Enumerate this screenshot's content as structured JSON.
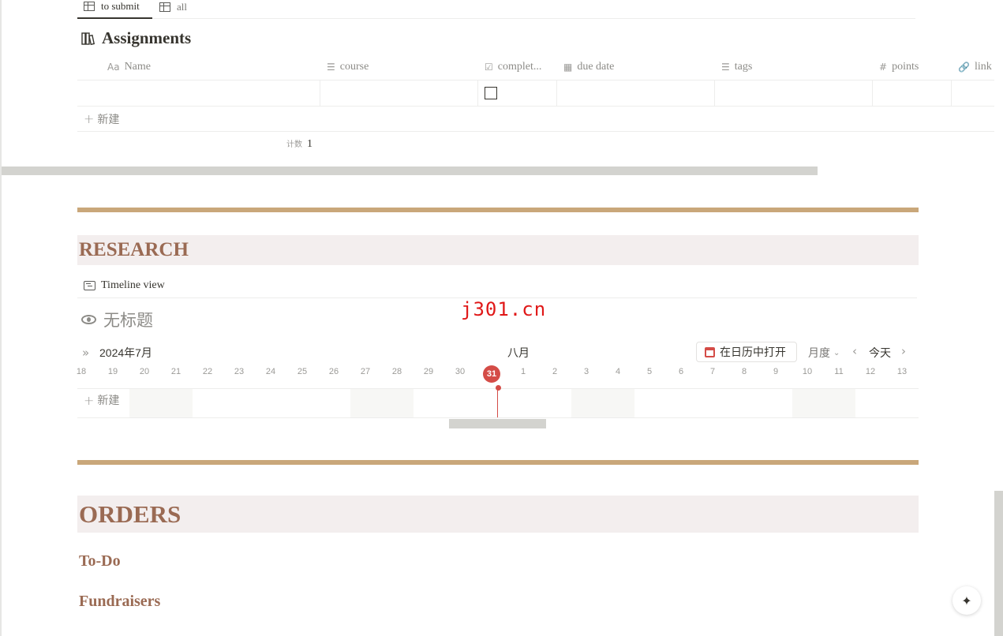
{
  "tabs": [
    {
      "label": "to submit",
      "icon": "table-icon"
    },
    {
      "label": "all",
      "icon": "table-icon"
    }
  ],
  "assignments": {
    "title": "Assignments",
    "columns": [
      {
        "icon": "Aa",
        "label": "Name"
      },
      {
        "icon": "☰",
        "label": "course"
      },
      {
        "icon": "☑",
        "label": "complet..."
      },
      {
        "icon": "▦",
        "label": "due date"
      },
      {
        "icon": "☰",
        "label": "tags"
      },
      {
        "icon": "#",
        "label": "points"
      },
      {
        "icon": "🔗",
        "label": "link"
      }
    ],
    "rows": [
      {
        "name": "",
        "course": "",
        "completed": false,
        "due_date": "",
        "tags": "",
        "points": "",
        "link": ""
      }
    ],
    "new_label": "新建",
    "count_label": "计数",
    "count_value": "1"
  },
  "research": {
    "heading": "RESEARCH",
    "view_label": "Timeline view",
    "db_title": "无标题",
    "month_left": "2024年7月",
    "month_right": "八月",
    "open_calendar": "在日历中打开",
    "scale": "月度",
    "today": "今天",
    "days": [
      "18",
      "19",
      "20",
      "21",
      "22",
      "23",
      "24",
      "25",
      "26",
      "27",
      "28",
      "29",
      "30",
      "31",
      "1",
      "2",
      "3",
      "4",
      "5",
      "6",
      "7",
      "8",
      "9",
      "10",
      "11",
      "12",
      "13"
    ],
    "today_day": "31",
    "new_label": "新建"
  },
  "watermark": "j301.cn",
  "orders": {
    "heading": "ORDERS",
    "subheadings": [
      "To-Do",
      "Fundraisers"
    ]
  },
  "colors": {
    "accent_divider": "#c9a77a",
    "heading_text": "#9a6a53",
    "heading_bg": "#f3eeee",
    "today_red": "#d44c47"
  }
}
